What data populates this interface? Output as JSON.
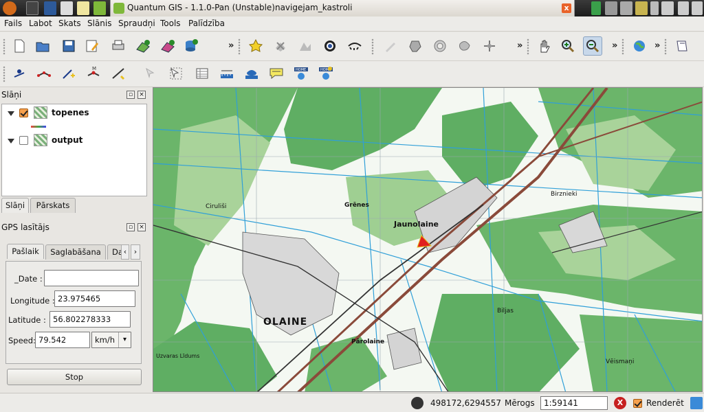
{
  "window": {
    "title": "Quantum GIS - 1.1.0-Pan (Unstable)navigejam_kastroli",
    "close_glyph": "x"
  },
  "menu": [
    "Fails",
    "Labot",
    "Skats",
    "Slānis",
    "Spraudņi",
    "Tools",
    "Palīdzība"
  ],
  "layers_panel": {
    "title": "Slāņi",
    "layers": [
      {
        "name": "topenes",
        "checked": true
      },
      {
        "name": "output",
        "checked": false
      }
    ],
    "tabs": [
      "Slāņi",
      "Pārskats"
    ]
  },
  "gps_panel": {
    "title": "GPS lasītājs",
    "tabs": [
      "Pašlaik",
      "Saglabāšana",
      "Da"
    ],
    "fields": {
      "date_label": "_Date :",
      "date_value": "",
      "longitude_label": "Longitude :",
      "longitude_value": "23.975465",
      "latitude_label": "Latitude :",
      "latitude_value": "56.802278333",
      "speed_label": "Speed:",
      "speed_value": "79.542",
      "speed_unit": "km/h"
    },
    "stop_label": "Stop"
  },
  "map": {
    "labels": [
      "Jaunolaine",
      "OLAINE",
      "Grēnes",
      "Birznieki",
      "Pārolaine",
      "Biljas",
      "Vēismaņi",
      "Uzvaras Līdums",
      "Ciruliši"
    ],
    "colors": {
      "forest": "#5fae63",
      "light_forest": "#a9d39a",
      "water": "#2f9fd8",
      "rail": "#8a4a3a",
      "road": "#333333",
      "marker": "#e02020"
    }
  },
  "status": {
    "coords": "498172,6294557",
    "scale_label": "Mērogs",
    "scale_value": "1:59141",
    "render_label": "Renderēt",
    "render_checked": true
  }
}
